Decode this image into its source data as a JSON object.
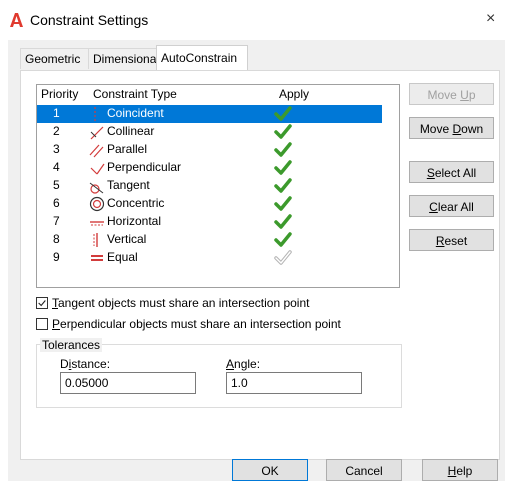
{
  "window": {
    "title": "Constraint Settings",
    "close_glyph": "×"
  },
  "tabs": [
    {
      "label": "Geometric"
    },
    {
      "label": "Dimensional"
    },
    {
      "label": "AutoConstrain",
      "active": true
    }
  ],
  "list": {
    "headers": {
      "priority": "Priority",
      "type": "Constraint Type",
      "apply": "Apply"
    },
    "rows": [
      {
        "priority": "1",
        "name": "Coincident",
        "icon": "coincident-icon",
        "applied": true,
        "selected": true
      },
      {
        "priority": "2",
        "name": "Collinear",
        "icon": "collinear-icon",
        "applied": true
      },
      {
        "priority": "3",
        "name": "Parallel",
        "icon": "parallel-icon",
        "applied": true
      },
      {
        "priority": "4",
        "name": "Perpendicular",
        "icon": "perpendicular-icon",
        "applied": true
      },
      {
        "priority": "5",
        "name": "Tangent",
        "icon": "tangent-icon",
        "applied": true
      },
      {
        "priority": "6",
        "name": "Concentric",
        "icon": "concentric-icon",
        "applied": true
      },
      {
        "priority": "7",
        "name": "Horizontal",
        "icon": "horizontal-icon",
        "applied": true
      },
      {
        "priority": "8",
        "name": "Vertical",
        "icon": "vertical-icon",
        "applied": true
      },
      {
        "priority": "9",
        "name": "Equal",
        "icon": "equal-icon",
        "applied": false
      }
    ]
  },
  "side_buttons": {
    "move_up": {
      "pre": "Move ",
      "key": "U",
      "post": "p"
    },
    "move_down": {
      "pre": "Move ",
      "key": "D",
      "post": "own"
    },
    "select_all": {
      "pre": "",
      "key": "S",
      "post": "elect All"
    },
    "clear_all": {
      "pre": "",
      "key": "C",
      "post": "lear All"
    },
    "reset": {
      "pre": "",
      "key": "R",
      "post": "eset"
    }
  },
  "options": {
    "tangent": {
      "key": "T",
      "rest": "angent objects must share an intersection point",
      "checked": true
    },
    "perpendicular": {
      "key": "P",
      "rest": "erpendicular objects must share an intersection point",
      "checked": false
    }
  },
  "tolerances": {
    "title": "Tolerances",
    "distance_label": {
      "pre": "D",
      "key": "i",
      "post": "stance:"
    },
    "distance_value": "0.05000",
    "angle_label": {
      "pre": "",
      "key": "A",
      "post": "ngle:"
    },
    "angle_value": "1.0"
  },
  "footer": {
    "ok": "OK",
    "cancel": "Cancel",
    "help": {
      "key": "H",
      "post": "elp"
    }
  },
  "colors": {
    "accent": "#0078d7",
    "check_green": "#3c9a2c",
    "check_gray": "#b5b5b5",
    "icon_red": "#d23c3c",
    "app_icon_red": "#e03a2f"
  }
}
